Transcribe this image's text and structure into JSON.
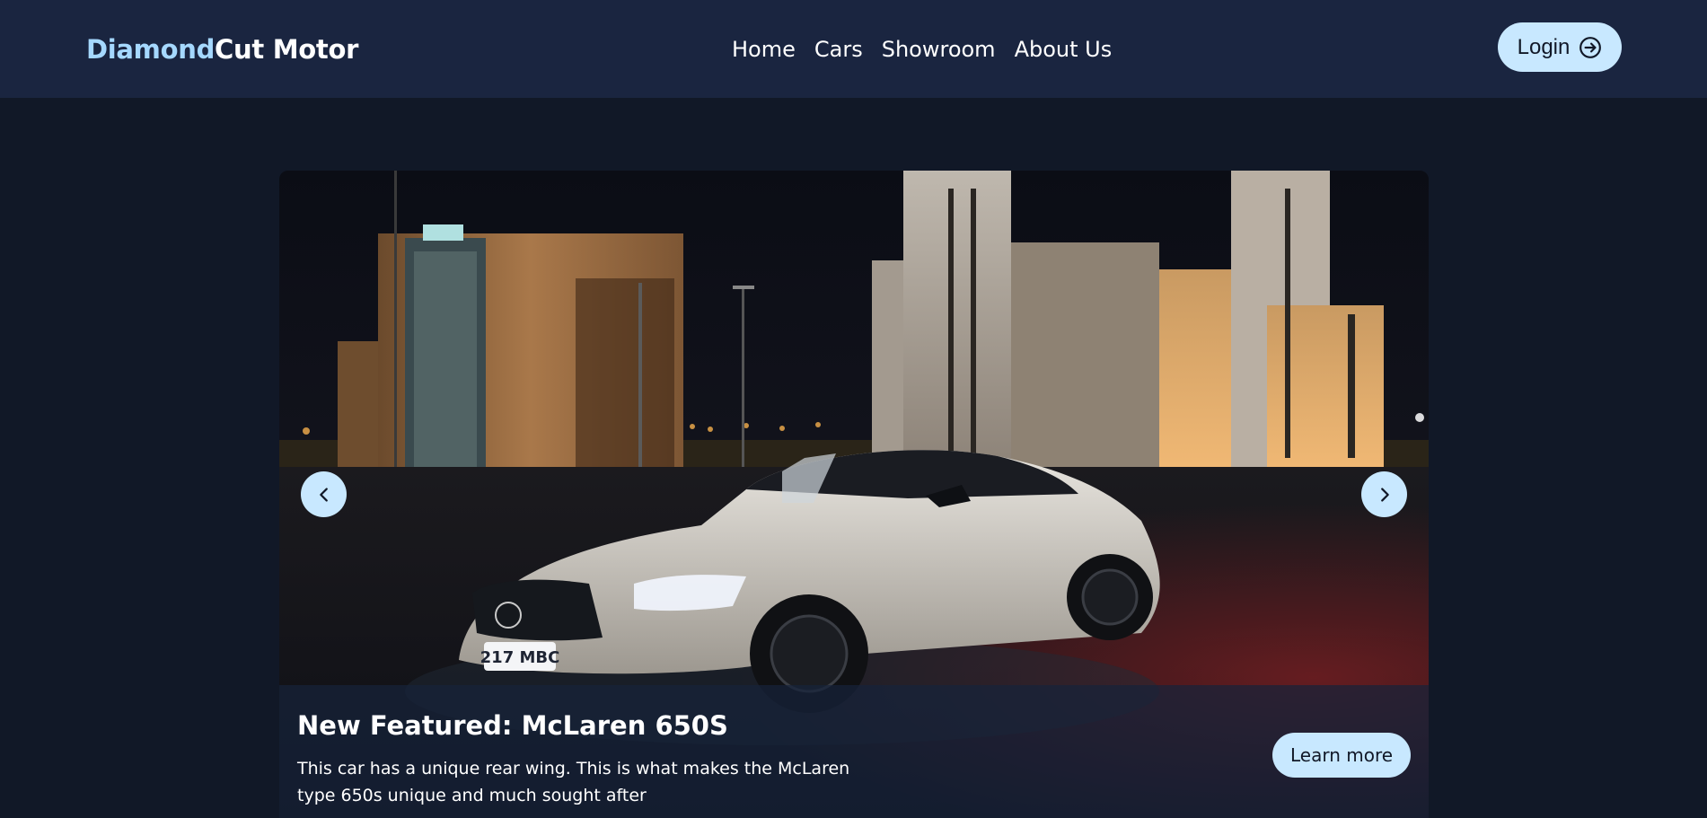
{
  "header": {
    "brand_accent": "Diamond",
    "brand_rest": "Cut Motor",
    "nav": [
      "Home",
      "Cars",
      "Showroom",
      "About Us"
    ],
    "login_label": "Login",
    "login_icon": "login-arrow-icon"
  },
  "carousel": {
    "image_alt": "White Mercedes coupe at night",
    "title": "New Featured: McLaren 650S",
    "text": "This car has a unique rear wing. This is what makes the McLaren type 650s unique and much sought after",
    "learn_more_label": "Learn more",
    "plate": "217 MBC",
    "prev_icon": "chevron-left-icon",
    "next_icon": "chevron-right-icon"
  },
  "colors": {
    "accent": "#a5d8ff",
    "button_bg": "#c8e8ff",
    "navbar_bg": "#1a2540",
    "page_bg": "#111827"
  }
}
